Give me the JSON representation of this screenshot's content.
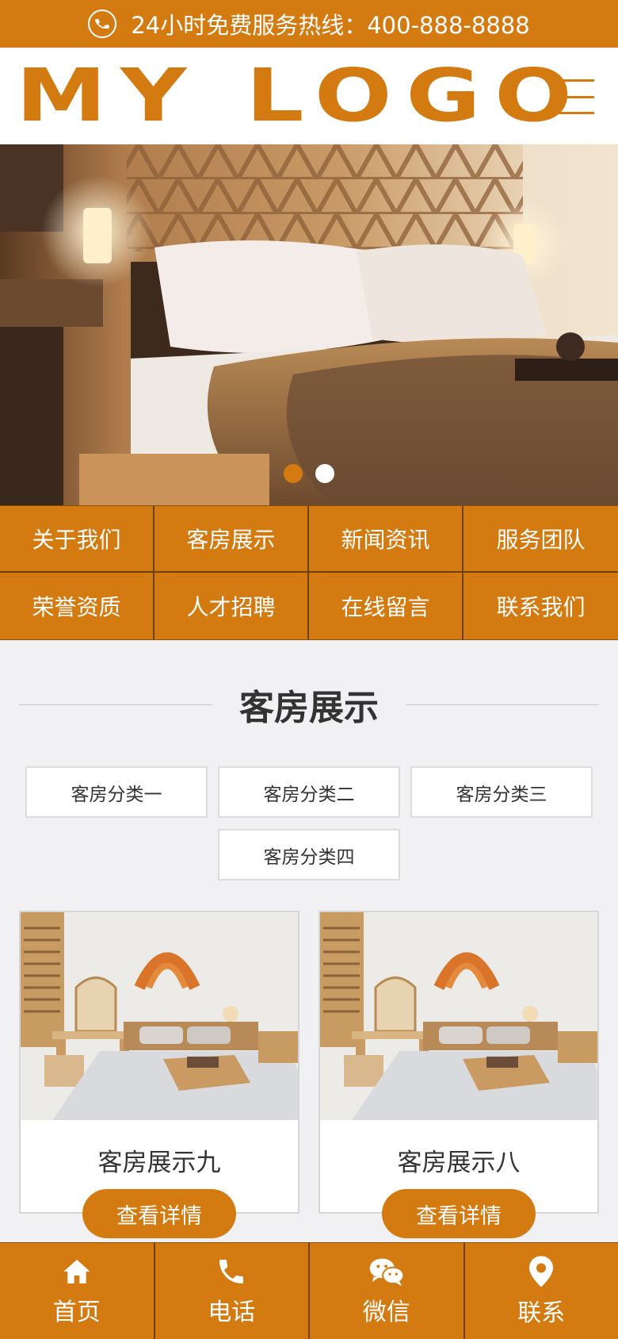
{
  "topbar": {
    "hotline": "24小时免费服务热线：400-888-8888",
    "icon": "phone-icon"
  },
  "header": {
    "logo_text": "MY LOGO",
    "menu_icon": "hamburger-menu-icon"
  },
  "banner": {
    "slide_count": 2,
    "active_slide": 1
  },
  "nav": {
    "items": [
      {
        "label": "关于我们"
      },
      {
        "label": "客房展示"
      },
      {
        "label": "新闻资讯"
      },
      {
        "label": "服务团队"
      },
      {
        "label": "荣誉资质"
      },
      {
        "label": "人才招聘"
      },
      {
        "label": "在线留言"
      },
      {
        "label": "联系我们"
      }
    ]
  },
  "section": {
    "title": "客房展示",
    "categories": [
      {
        "label": "客房分类一"
      },
      {
        "label": "客房分类二"
      },
      {
        "label": "客房分类三"
      },
      {
        "label": "客房分类四"
      }
    ]
  },
  "products": [
    {
      "name": "客房展示九",
      "button": "查看详情"
    },
    {
      "name": "客房展示八",
      "button": "查看详情"
    }
  ],
  "bottom_nav": {
    "items": [
      {
        "label": "首页",
        "icon": "home-icon"
      },
      {
        "label": "电话",
        "icon": "phone-icon"
      },
      {
        "label": "微信",
        "icon": "wechat-icon"
      },
      {
        "label": "联系",
        "icon": "location-pin-icon"
      }
    ]
  },
  "colors": {
    "accent": "#d37a11",
    "page_background": "#f1f1f3"
  }
}
